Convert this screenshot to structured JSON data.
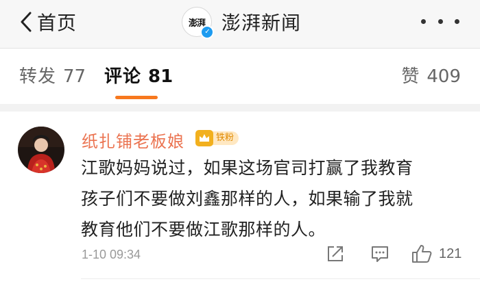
{
  "nav": {
    "back_label": "首页",
    "logo_text": "澎湃",
    "title": "澎湃新闻"
  },
  "tabs": [
    {
      "label": "转发",
      "count": "77",
      "active": false
    },
    {
      "label": "评论",
      "count": "81",
      "active": true
    },
    {
      "label": "赞",
      "count": "409",
      "active": false
    }
  ],
  "comment": {
    "username": "纸扎铺老板娘",
    "fan_badge": "铁粉",
    "text_lines": [
      "江歌妈妈说过，如果这场官司打赢了我教育",
      "孩子们不要做刘鑫那样的人，如果输了我就",
      "教育他们不要做江歌那样的人。"
    ],
    "timestamp": "1-10 09:34",
    "like_count": "121"
  },
  "colors": {
    "accent_orange": "#f7781e",
    "username": "#eb7350",
    "verified_blue": "#1d9bf0",
    "badge_gold": "#f2b01e"
  },
  "icons": [
    "chevron-left-icon",
    "verified-icon",
    "more-icon",
    "crown-icon",
    "share-icon",
    "reply-icon",
    "thumbs-up-icon"
  ]
}
